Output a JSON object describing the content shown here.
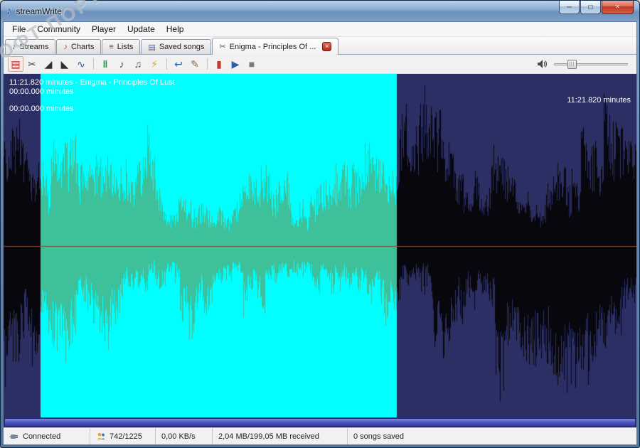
{
  "window": {
    "title": "streamWriter",
    "icon": "♪",
    "controls": {
      "minimize": "─",
      "maximize": "□",
      "close": "×"
    }
  },
  "watermark": "СОФТ ПОРТАЛ",
  "menu": {
    "items": [
      "File",
      "Community",
      "Player",
      "Update",
      "Help"
    ]
  },
  "tabs": [
    {
      "label": "Streams",
      "glyph": "♪",
      "style": "color:#2b5fa3"
    },
    {
      "label": "Charts",
      "glyph": "♪",
      "style": "color:#a33b2b"
    },
    {
      "label": "Lists",
      "glyph": "≡",
      "style": "color:#2b5fa3"
    },
    {
      "label": "Saved songs",
      "glyph": "▤",
      "style": "color:#4a6da3"
    },
    {
      "label": "Enigma - Principles Of ...",
      "glyph": "✂",
      "style": "color:#555",
      "close": "×"
    }
  ],
  "toolbar": {
    "icons": [
      {
        "name": "save",
        "glyph": "▤",
        "style": "color:#b03030"
      },
      {
        "name": "cut",
        "glyph": "✂",
        "style": "color:#444"
      },
      {
        "name": "fade-in",
        "glyph": "◢",
        "style": "color:#2f2f2f"
      },
      {
        "name": "fade-out",
        "glyph": "◣",
        "style": "color:#2f2f2f"
      },
      {
        "name": "effects",
        "glyph": "∿",
        "style": "color:#335a99"
      },
      {
        "name": "silence",
        "glyph": "‖",
        "style": "color:#1f8f3a; font-weight:bold"
      },
      {
        "name": "mute-start",
        "glyph": "♪",
        "style": "color:#555"
      },
      {
        "name": "mute-end",
        "glyph": "♫",
        "style": "color:#555"
      },
      {
        "name": "apply-fx",
        "glyph": "⚡",
        "style": "color:#d9a514"
      },
      {
        "name": "undo",
        "glyph": "↩",
        "style": "color:#2b5fa3"
      },
      {
        "name": "auto-cut",
        "glyph": "✎",
        "style": "color:#8a6d2f"
      },
      {
        "name": "set-position",
        "glyph": "▮",
        "style": "color:#c0392b"
      },
      {
        "name": "play",
        "glyph": "▶",
        "style": "color:#2b5fa3"
      },
      {
        "name": "stop",
        "glyph": "■",
        "style": "color:#7a7a7a"
      }
    ],
    "volume_grip": "|||"
  },
  "wave": {
    "line1": "11:21.820 minutes - Enigma - Principles Of Lust",
    "line2": "00:00.000 minutes",
    "line3": "00:00.000 minutes",
    "right": "11:21.820 minutes",
    "colors": {
      "bg": "#2c2f63",
      "wave": "#07070d",
      "sel_bg": "#00ffff",
      "sel_wave": "#3ec09b",
      "center": "#8a4a3a"
    },
    "selection": {
      "start": 52,
      "end": 553
    }
  },
  "statusbar": {
    "connected": "Connected",
    "songs_ratio": "742/1225",
    "speed": "0,00 KB/s",
    "received": "2,04 MB/199,05 MB received",
    "saved": "0 songs saved"
  }
}
